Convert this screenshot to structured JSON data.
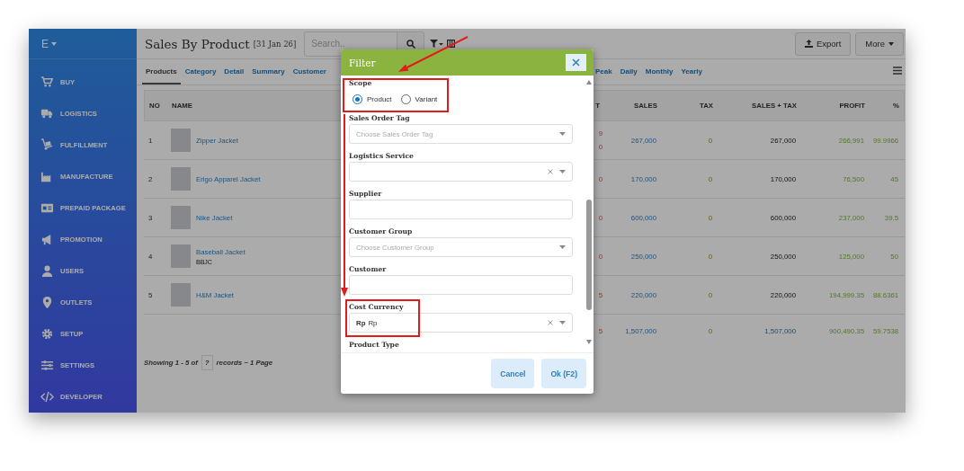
{
  "sidebar": {
    "brand": "E",
    "items": [
      {
        "label": "BUY"
      },
      {
        "label": "LOGISTICS"
      },
      {
        "label": "FULFILLMENT"
      },
      {
        "label": "MANUFACTURE"
      },
      {
        "label": "PREPAID PACKAGE"
      },
      {
        "label": "PROMOTION"
      },
      {
        "label": "USERS"
      },
      {
        "label": "OUTLETS"
      },
      {
        "label": "SETUP"
      },
      {
        "label": "SETTINGS"
      },
      {
        "label": "DEVELOPER"
      }
    ]
  },
  "header": {
    "title": "Sales By Product",
    "date": "[31 Jan 26]",
    "search": {
      "placeholder": "Search.."
    },
    "buttons": [
      {
        "kind": "export",
        "label": "Export"
      },
      {
        "kind": "dropdown",
        "label": "More"
      }
    ]
  },
  "tabs": [
    {
      "label": "Products",
      "selected": true
    },
    {
      "label": "Category",
      "selected": false
    },
    {
      "label": "Detail",
      "selected": false
    },
    {
      "label": "Summary",
      "selected": false
    },
    {
      "label": "Customer",
      "selected": false
    },
    {
      "label": "Peak",
      "selected": false
    },
    {
      "label": "Daily",
      "selected": false
    },
    {
      "label": "Monthly",
      "selected": false
    },
    {
      "label": "Yearly",
      "selected": false
    }
  ],
  "table": {
    "columns": [
      "NO",
      "NAME",
      "T",
      "SALES",
      "TAX",
      "SALES + TAX",
      "PROFIT",
      "%"
    ],
    "rows": [
      {
        "no": "1",
        "name": "Zipper Jacket",
        "cost": [
          "9",
          "0"
        ],
        "sales": "267,000",
        "tax": "0",
        "sales_tax": "267,000",
        "profit": "266,991",
        "percent": "99.9966"
      },
      {
        "no": "2",
        "name": "Erigo Apparel Jacket",
        "cost": [
          "0"
        ],
        "sales": "170,000",
        "tax": "0",
        "sales_tax": "170,000",
        "profit": "76,500",
        "percent": "45"
      },
      {
        "no": "3",
        "name": "Nike Jacket",
        "cost": [
          "0"
        ],
        "sales": "600,000",
        "tax": "0",
        "sales_tax": "600,000",
        "profit": "237,000",
        "percent": "39.5"
      },
      {
        "no": "4",
        "name": "Baseball Jacket",
        "code": "BBJC",
        "cost": [
          "0"
        ],
        "sales": "250,000",
        "tax": "0",
        "sales_tax": "250,000",
        "profit": "125,000",
        "percent": "50"
      },
      {
        "no": "5",
        "name": "H&M Jacket",
        "cost": [
          "5"
        ],
        "sales": "220,000",
        "tax": "0",
        "sales_tax": "220,000",
        "profit": "194,999.35",
        "percent": "88.6361"
      }
    ],
    "total": {
      "cost": [
        "5"
      ],
      "sales": "1,507,000",
      "tax": "0",
      "sales_tax": "1,507,000",
      "profit": "900,490.35",
      "percent": "59.7538"
    }
  },
  "footer": {
    "showing": "Showing 1 - 5 of",
    "count": "?",
    "records": "records ~ 1 Page"
  },
  "modal": {
    "title": "Filter",
    "fields": [
      {
        "kind": "radio",
        "label": "Scope",
        "options": [
          {
            "label": "Product",
            "selected": true
          },
          {
            "label": "Variant",
            "selected": false
          }
        ]
      },
      {
        "kind": "select",
        "label": "Sales Order Tag",
        "placeholder": "Choose Sales Order Tag",
        "clearable": false
      },
      {
        "kind": "select",
        "label": "Logistics Service",
        "clearable": true
      },
      {
        "kind": "text",
        "label": "Supplier"
      },
      {
        "kind": "select",
        "label": "Customer Group",
        "placeholder": "Choose Customer Group",
        "clearable": false
      },
      {
        "kind": "text",
        "label": "Customer"
      },
      {
        "kind": "select",
        "label": "Cost Currency",
        "symbol": "Rp",
        "value": "Rp",
        "clearable": true
      },
      {
        "kind": "label",
        "label": "Product Type"
      }
    ],
    "buttons": [
      "Cancel",
      "Ok (F2)"
    ]
  }
}
